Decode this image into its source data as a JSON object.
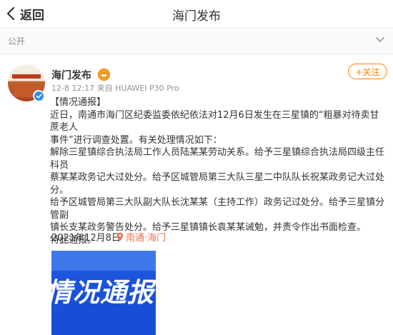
{
  "topbar": {
    "back_label": "返回",
    "title": "海门发布"
  },
  "visibility": {
    "label": "公开"
  },
  "post": {
    "account_name": "海门发布",
    "meta": "12-8 12:17  来自 HUAWEI P30 Pro",
    "follow_label": "+关注",
    "lines": [
      "【情况通报】",
      "近日，南通市海门区纪委监委依纪依法对12月6日发生在三星镇的“粗暴对待卖甘蔗老人",
      "事件”进行调查处置。有关处理情况如下：",
      "解除三星镇综合执法局工作人员陆某某劳动关系。给予三星镇综合执法局四级主任科员",
      "蔡某某政务记大过处分。给予区城管局第三大队三星二中队队长祝某政务记大过处分。",
      "给予区城管局第三大队副大队长沈某某（主持工作）政务记过处分。给予三星镇分管副",
      "镇长支某政务警告处分。给予三星镇镇长袁某某诫勉，并责令作出书面检查。",
      "特此通报。"
    ],
    "date": "2021年12月8日",
    "location": "南通·海门",
    "image_text": "情况通报"
  },
  "icons": {
    "back": "chevron-left-icon",
    "dropdown": "chevron-down-icon",
    "verified": "verified-icon",
    "vip": "vip-crown-icon",
    "location": "location-pin-icon"
  },
  "colors": {
    "accent": "#ff8200",
    "location": "#eb7350",
    "verified": "#2e8fe8",
    "image_bg": "#1f5be0"
  }
}
